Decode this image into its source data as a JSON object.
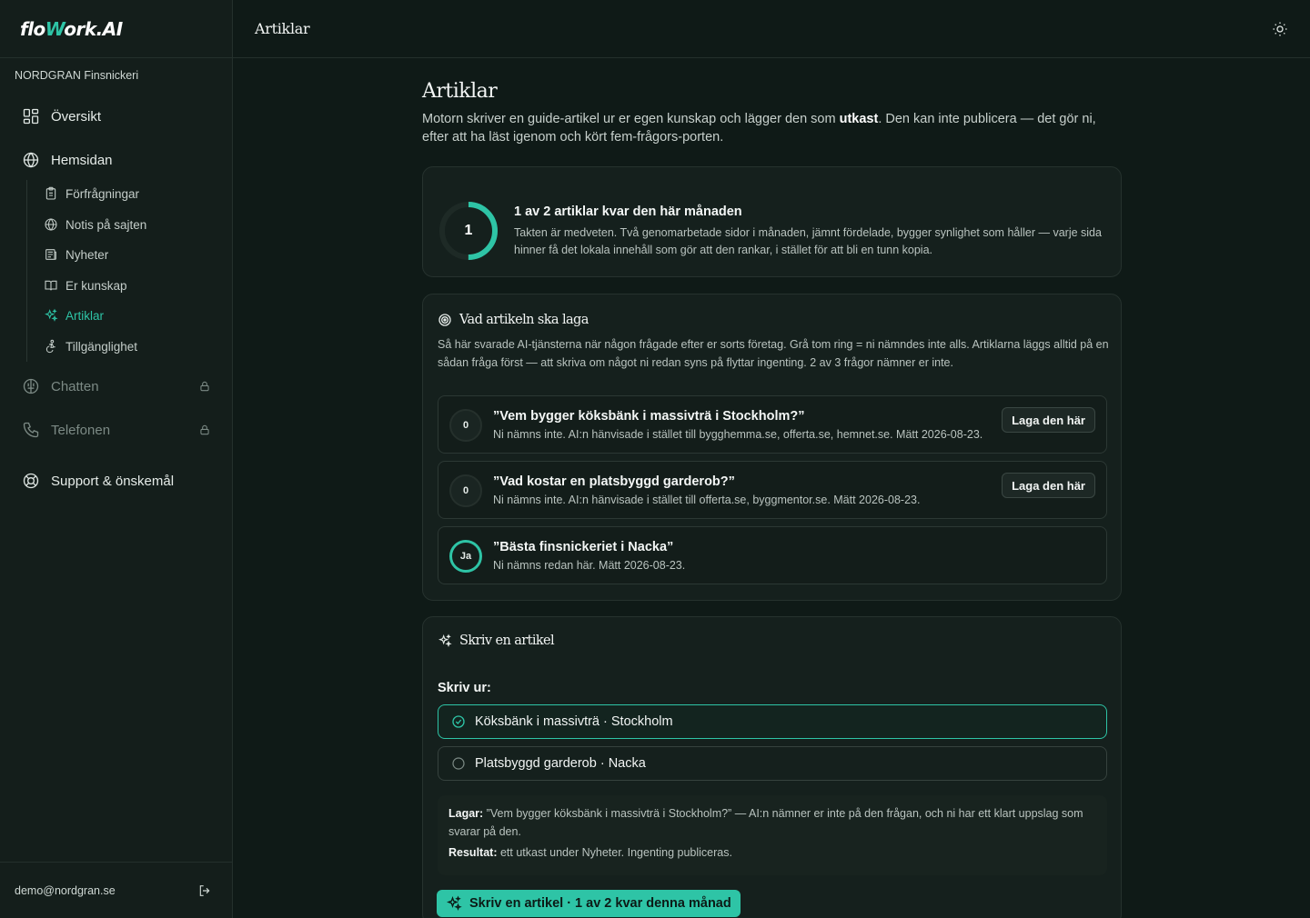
{
  "app": {
    "logo_pre": "flo",
    "logo_accent": "W",
    "logo_post": "ork.AI",
    "org_name": "NORDGRAN Finsnickeri",
    "user_email": "demo@nordgran.se"
  },
  "nav": {
    "overview": "Översikt",
    "website": "Hemsidan",
    "sub": [
      "Förfrågningar",
      "Notis på sajten",
      "Nyheter",
      "Er kunskap",
      "Artiklar",
      "Tillgänglighet"
    ],
    "chat": "Chatten",
    "phone": "Telefonen",
    "support": "Support & önskemål"
  },
  "topbar": {
    "title": "Artiklar"
  },
  "page": {
    "title": "Artiklar",
    "lead_pre": "Motorn skriver en guide-artikel ur er egen kunskap och lägger den som ",
    "lead_bold": "utkast",
    "lead_post": ". Den kan inte publicera — det gör ni, efter att ha läst igenom och kört fem-frågors-porten."
  },
  "quota": {
    "used": 1,
    "total": 2,
    "ring_value": "1",
    "heading": "1 av 2 artiklar kvar den här månaden",
    "text": "Takten är medveten. Två genomarbetade sidor i månaden, jämnt fördelade, bygger synlighet som håller — varje sida hinner få det lokala innehåll som gör att den rankar, i stället för att bli en tunn kopia."
  },
  "questions": {
    "heading": "Vad artikeln ska laga",
    "description": "Så här svarade AI-tjänsterna när någon frågade efter er sorts företag. Grå tom ring = ni nämndes inte alls. Artiklarna läggs alltid på en sådan fråga först — att skriva om något ni redan syns på flyttar ingenting. 2 av 3 frågor nämner er inte.",
    "button_label": "Laga den här",
    "items": [
      {
        "badge": "0",
        "title": "”Vem bygger köksbänk i massivträ i Stockholm?”",
        "meta": "Ni nämns inte. AI:n hänvisade i stället till bygghemma.se, offerta.se, hemnet.se. Mätt 2026-08-23."
      },
      {
        "badge": "0",
        "title": "”Vad kostar en platsbyggd garderob?”",
        "meta": "Ni nämns inte. AI:n hänvisade i stället till offerta.se, byggmentor.se. Mätt 2026-08-23."
      },
      {
        "badge": "Ja",
        "title": "”Bästa finsnickeriet i Nacka”",
        "meta": "Ni nämns redan här. Mätt 2026-08-23."
      }
    ]
  },
  "write": {
    "heading": "Skriv en artikel",
    "label": "Skriv ur:",
    "options": [
      "Köksbänk i massivträ · Stockholm",
      "Platsbyggd garderob · Nacka"
    ],
    "selected_index": 0,
    "fixes_label": "Lagar:",
    "fixes_text": " ”Vem bygger köksbänk i massivträ i Stockholm?” — AI:n nämner er inte på den frågan, och ni har ett klart uppslag som svarar på den.",
    "result_label": "Resultat:",
    "result_text": " ett utkast under Nyheter. Ingenting publiceras.",
    "cta": "Skriv en artikel · 1 av 2 kvar denna månad"
  },
  "colors": {
    "accent": "#2ec4a6",
    "background": "#0f1a17",
    "card": "#15201d"
  }
}
